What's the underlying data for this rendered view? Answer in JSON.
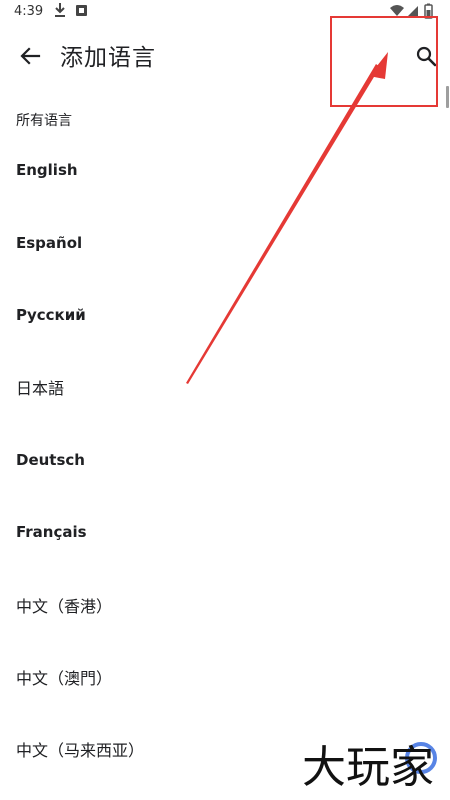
{
  "status_bar": {
    "time": "4:39"
  },
  "toolbar": {
    "title": "添加语言"
  },
  "list": {
    "section_header": "所有语言",
    "items": [
      "English",
      "Español",
      "Русский",
      "日本語",
      "Deutsch",
      "Français",
      "中文（香港）",
      "中文（澳門）",
      "中文（马来西亚）"
    ]
  },
  "watermark": {
    "text": "大玩家"
  },
  "colors": {
    "annotation": "#e53935",
    "text": "#202124",
    "background": "#ffffff"
  },
  "icons": [
    "back-arrow-icon",
    "search-icon",
    "download-icon",
    "wifi-icon",
    "signal-icon",
    "battery-icon"
  ]
}
